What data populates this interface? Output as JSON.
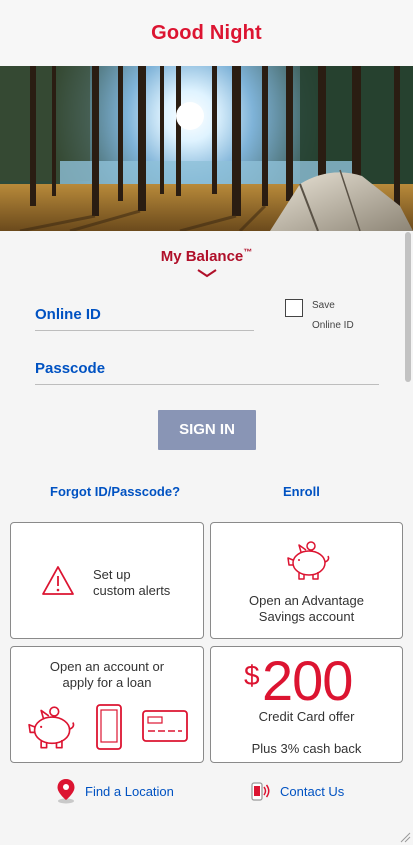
{
  "header": {
    "title": "Good Night"
  },
  "login": {
    "balance_label": "My Balance",
    "balance_tm": "™",
    "online_id_label": "Online ID",
    "save_label_1": "Save",
    "save_label_2": "Online ID",
    "passcode_label": "Passcode",
    "signin_label": "SIGN IN",
    "forgot_link": "Forgot ID/Passcode?",
    "enroll_link": "Enroll"
  },
  "cards": {
    "alerts_line1": "Set up",
    "alerts_line2": "custom alerts",
    "savings_line1": "Open an Advantage",
    "savings_line2": "Savings account",
    "account_line1": "Open an account or",
    "account_line2": "apply for a loan",
    "promo_dollar": "$",
    "promo_amount": "200",
    "promo_line1": "Credit Card offer",
    "promo_line2": "Plus 3% cash back"
  },
  "footer": {
    "location_label": "Find a Location",
    "contact_label": "Contact Us"
  },
  "colors": {
    "brand_red": "#dc1431",
    "link_blue": "#0052c2",
    "button_disabled": "#8995b5"
  },
  "icons": [
    "warning-icon",
    "piggy-bank-icon",
    "phone-icon",
    "credit-card-icon",
    "location-pin-icon",
    "contact-phone-icon",
    "chevron-down-icon"
  ]
}
